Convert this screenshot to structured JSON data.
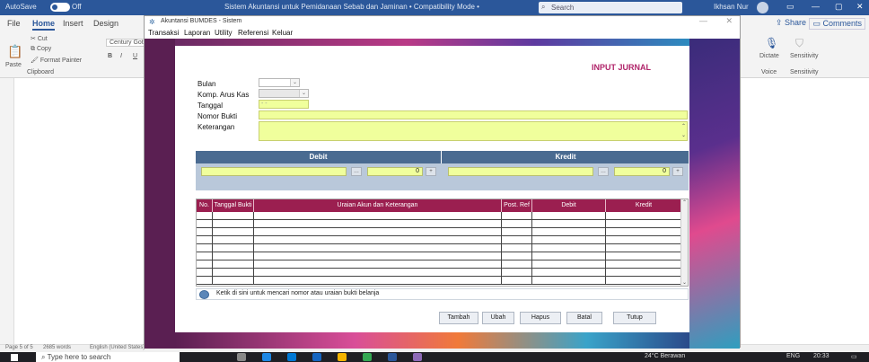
{
  "word": {
    "autosave": "AutoSave",
    "autosave_state": "Off",
    "title": "Sistem Akuntansi untuk Pemidanaan Sebab dan Jaminan • Compatibility Mode •",
    "search": "Search",
    "user": "Ikhsan Nur",
    "tabs": [
      "File",
      "Home",
      "Insert",
      "Design"
    ],
    "share": "Share",
    "comments": "Comments",
    "ribbon": {
      "cut": "Cut",
      "copy": "Copy",
      "paste": "Paste",
      "format_painter": "Format Painter",
      "clipboard": "Clipboard",
      "font": "Century Goth",
      "dictate": "Dictate",
      "voice": "Voice",
      "sensitivity": "Sensitivity"
    },
    "status": {
      "page": "Page 5 of 5",
      "words": "2685 words",
      "language": "English (United States)"
    }
  },
  "taskbar": {
    "search_placeholder": "Type here to search",
    "weather": "24°C  Berawan",
    "lang": "ENG",
    "time": "20:33"
  },
  "app": {
    "title": "Akuntansi BUMDES - Sistem",
    "menu": [
      "Transaksi",
      "Laporan",
      "Utility",
      "Referensi",
      "Keluar"
    ],
    "form_title": "INPUT JURNAL",
    "labels": {
      "bulan": "Bulan",
      "komp_arus_kas": "Komp. Arus Kas",
      "tanggal": "Tanggal",
      "nomor_bukti": "Nomor Bukti",
      "keterangan": "Keterangan"
    },
    "tanggal_value": "- -",
    "debit_header": "Debit",
    "kredit_header": "Kredit",
    "debit_amount": "0",
    "kredit_amount": "0",
    "table_columns": [
      "No.",
      "Tanggal Bukti",
      "Uraian Akun dan Keterangan",
      "Post. Ref",
      "Debit",
      "Kredit"
    ],
    "search_hint": "Ketik di sini untuk mencari nomor atau uraian bukti belanja",
    "buttons": [
      "Tambah",
      "Ubah",
      "Hapus",
      "Batal",
      "Tutup"
    ]
  }
}
